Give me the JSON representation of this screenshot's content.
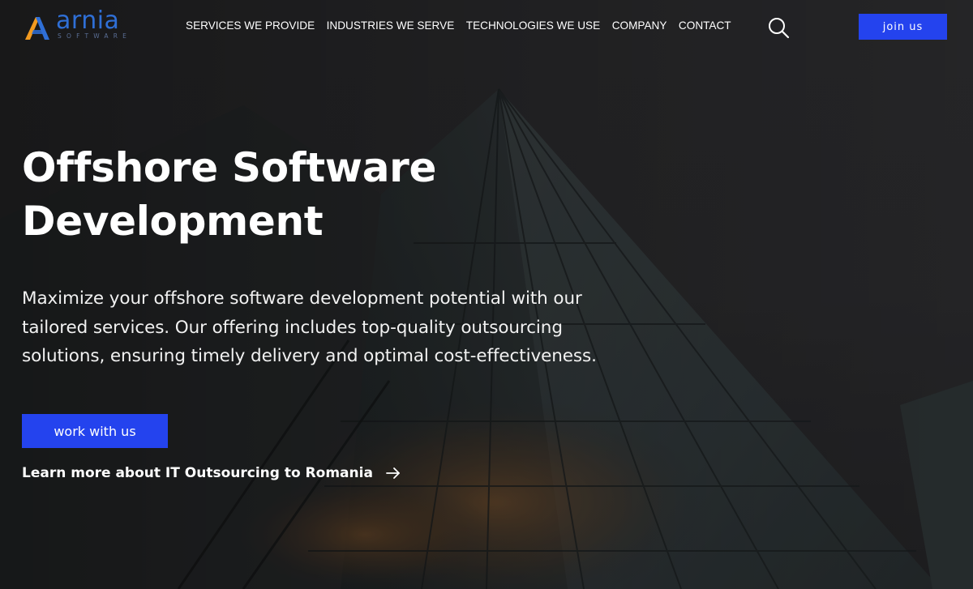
{
  "brand": {
    "name": "arnia",
    "tagline": "SOFTWARE",
    "colors": {
      "primary_blue": "#2443ee",
      "logo_blue": "#2f6fd6",
      "logo_orange": "#f29a1f"
    }
  },
  "nav": {
    "items": [
      {
        "label": "SERVICES WE PROVIDE"
      },
      {
        "label": "INDUSTRIES WE SERVE"
      },
      {
        "label": "TECHNOLOGIES WE USE"
      },
      {
        "label": "COMPANY"
      },
      {
        "label": "CONTACT"
      }
    ],
    "search_icon": "search-icon",
    "join_label": "join us"
  },
  "hero": {
    "title_line1": "Offshore Software",
    "title_line2": "Development",
    "subtitle_line1": "Maximize your offshore software development potential with our",
    "subtitle_line2": "tailored services. Our offering includes top-quality outsourcing",
    "subtitle_line3": "solutions, ensuring timely delivery and optimal cost-effectiveness.",
    "cta_label": "work with us",
    "learn_more_label": "Learn more about IT Outsourcing to Romania",
    "learn_more_icon": "arrow-right-icon",
    "background": "dark glass skyscraper photo"
  }
}
